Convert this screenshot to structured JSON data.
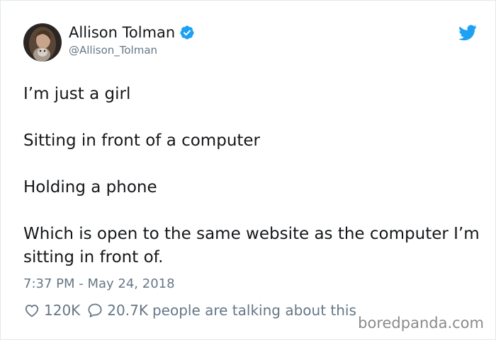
{
  "author": {
    "display_name": "Allison Tolman",
    "handle": "@Allison_Tolman",
    "verified": true,
    "avatar_icon": "profile-photo"
  },
  "tweet": {
    "lines": [
      "I’m just a girl",
      "Sitting in front of a computer",
      "Holding a phone",
      "Which is open to the same website as the computer I’m sitting in front of."
    ],
    "timestamp": "7:37 PM - May 24, 2018"
  },
  "stats": {
    "likes": "120K",
    "replies": "20.7K",
    "talking_label": "people are talking about this"
  },
  "branding": {
    "logo_icon": "twitter-bird-icon",
    "watermark": "boredpanda.com"
  },
  "colors": {
    "twitter_blue": "#1da1f2",
    "text": "#14171a",
    "muted": "#657786"
  }
}
